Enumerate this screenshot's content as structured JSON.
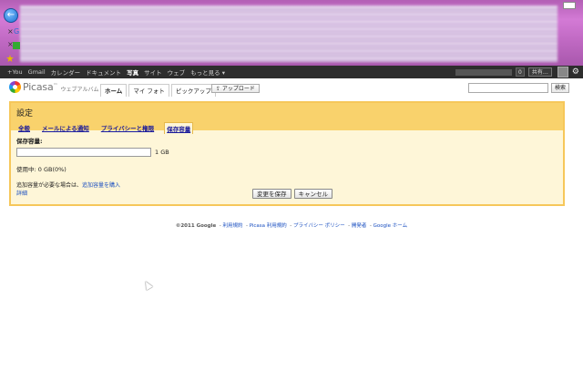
{
  "colors": {
    "gbar": "#2d2d2d",
    "panel_bg": "#fef6d8",
    "panel_border": "#f6c75a",
    "panel_head": "#f9d26c",
    "link": "#1a4fc0"
  },
  "browser": {
    "back_icon": "back-arrow-icon",
    "tabs": [
      {
        "close": "×",
        "text": "G"
      },
      {
        "close": "×",
        "text": ""
      }
    ]
  },
  "gbar": {
    "items": [
      "+You",
      "Gmail",
      "カレンダー",
      "ドキュメント",
      "写真",
      "サイト",
      "ウェブ",
      "もっと見る ▾"
    ],
    "active_index": 4,
    "share_label": "共有…",
    "gear_icon": "gear-icon"
  },
  "header": {
    "logo_text": "Picasa",
    "logo_sup": "™",
    "logo_sub": "ウェブアルバム",
    "tabs": [
      "ホーム",
      "マイ フォト",
      "ピックアップ"
    ],
    "upload_label": "⇪ アップロード",
    "search_button": "検索"
  },
  "settings": {
    "title": "設定",
    "tabs": [
      "全般",
      "メールによる通知",
      "プライバシーと権限",
      "保存容量"
    ],
    "active_tab": 3,
    "storage_label": "保存容量:",
    "storage_value": "",
    "storage_unit": "1 GB",
    "usage_text": "使用中: 0 GB(0%)",
    "buy_prefix": "追加容量が必要な場合は、",
    "buy_link": "追加容量を購入",
    "detail_link": "詳細",
    "save_button": "変更を保存",
    "cancel_button": "キャンセル"
  },
  "footer": {
    "copyright": "©2011 Google",
    "links": [
      "利用規約",
      "Picasa 利用規約",
      "プライバシー ポリシー",
      "開発者",
      "Google ホーム"
    ]
  }
}
